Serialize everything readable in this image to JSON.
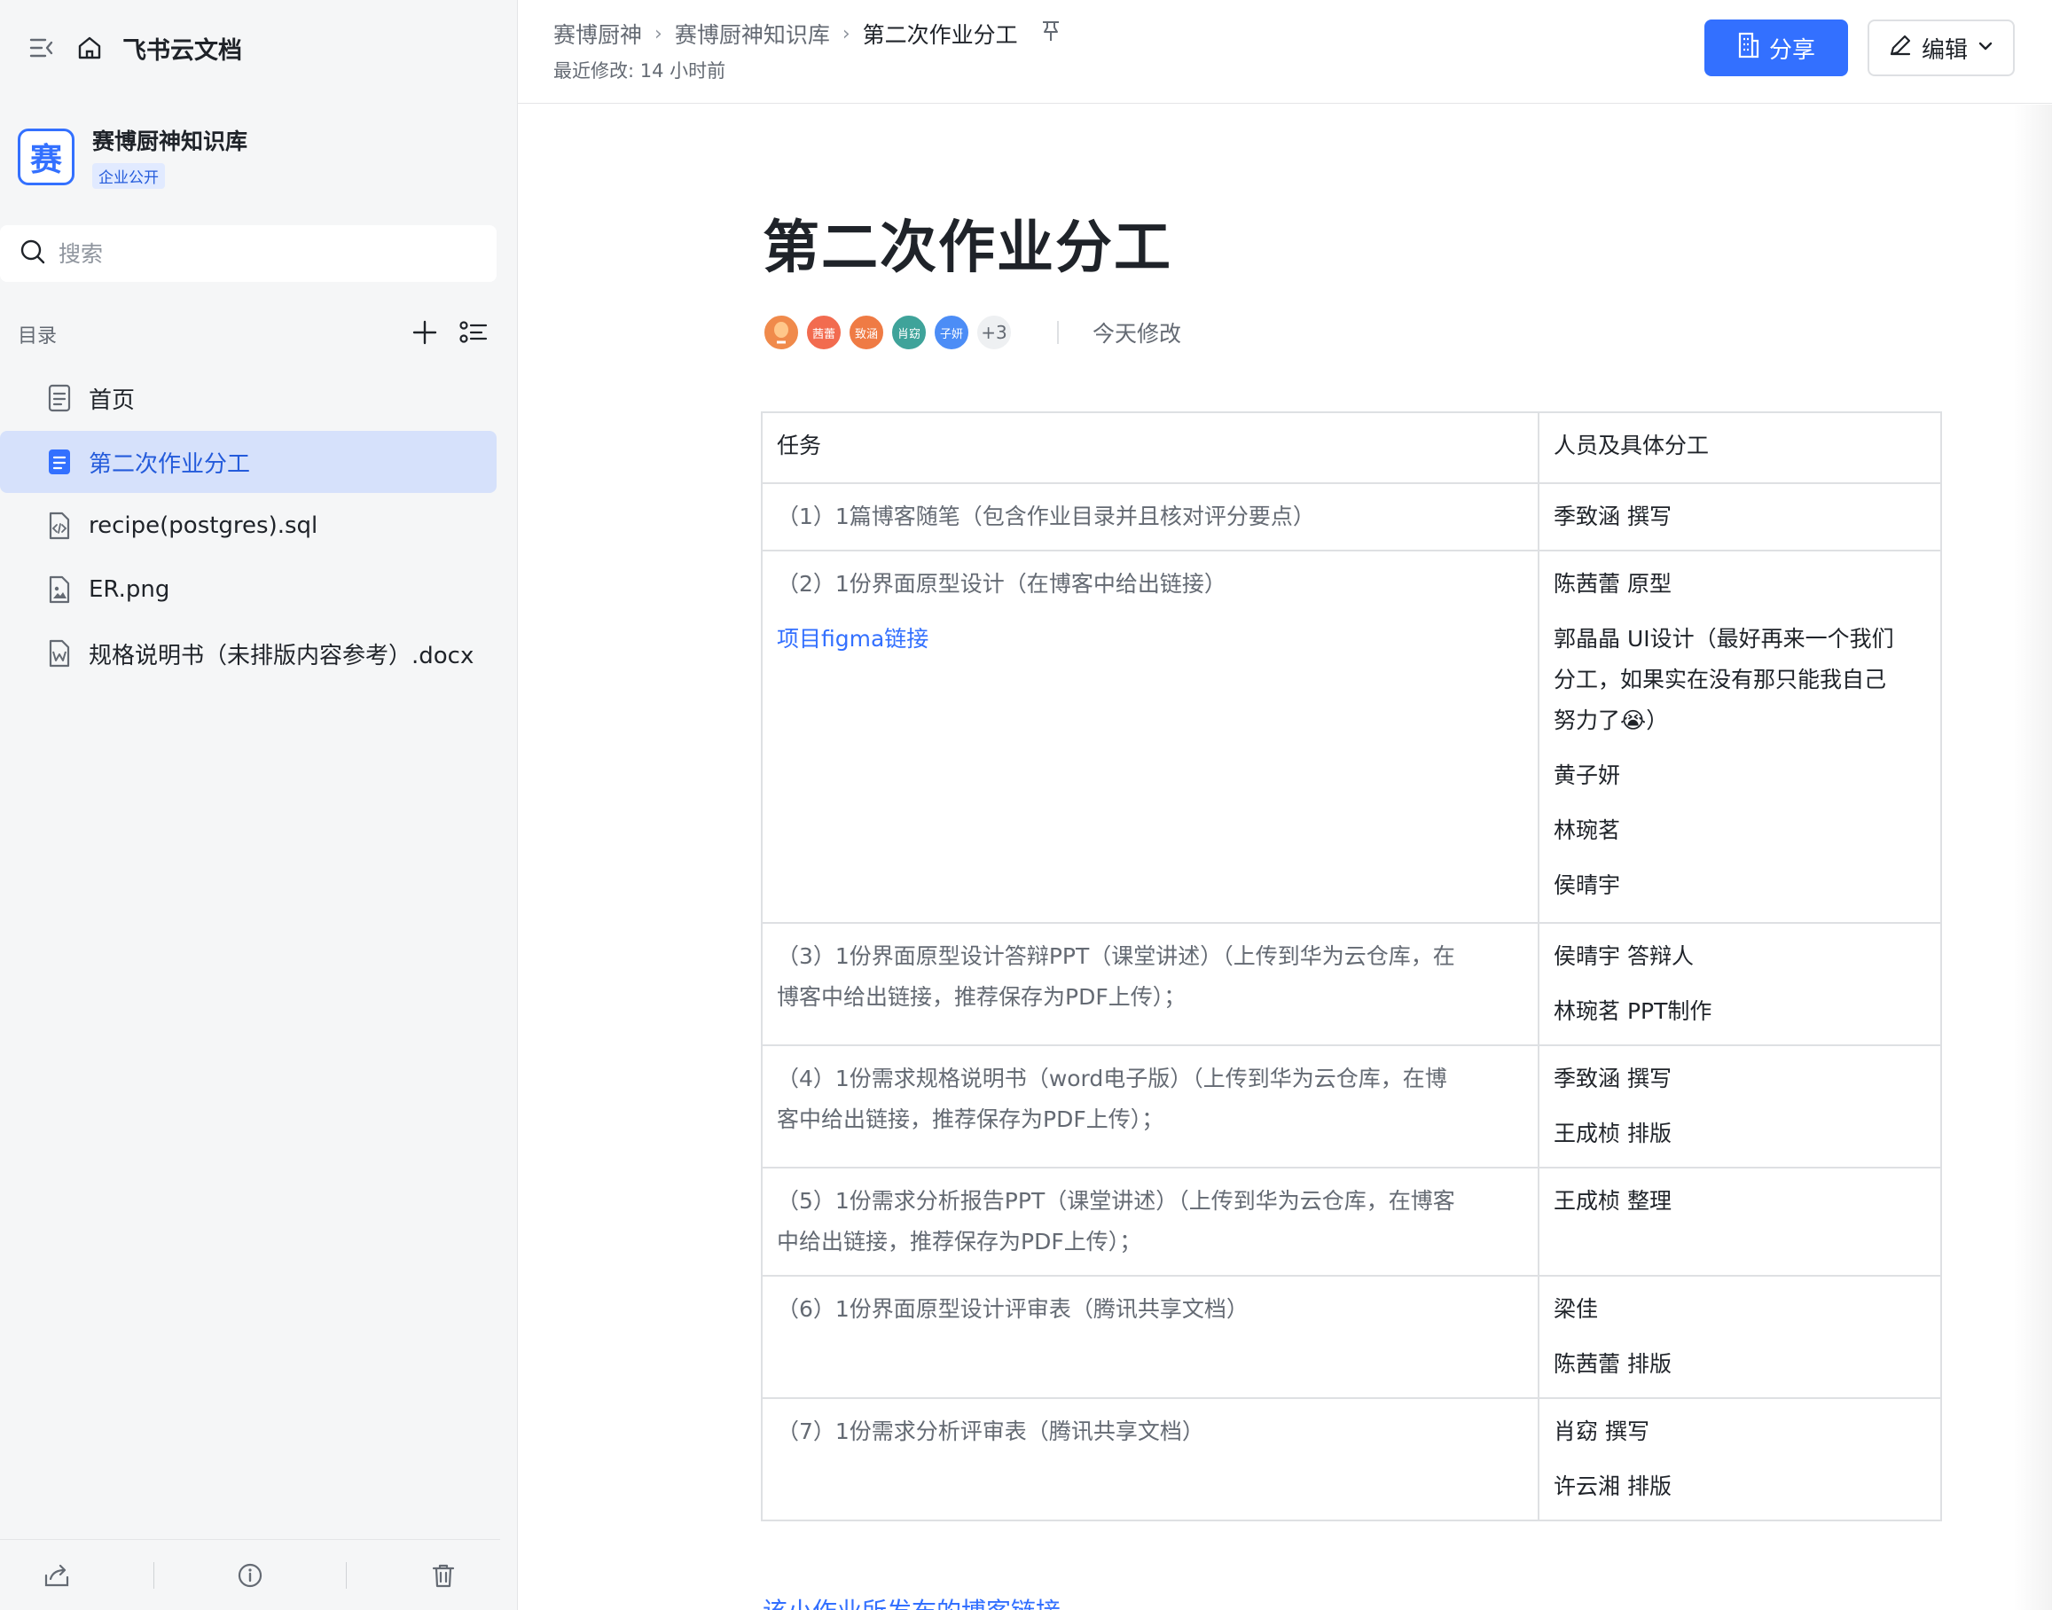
{
  "sidebar": {
    "app_name": "飞书云文档",
    "space": {
      "logo_char": "赛",
      "name": "赛博厨神知识库",
      "badge": "企业公开"
    },
    "search_placeholder": "搜索",
    "toc_title": "目录",
    "items": [
      {
        "label": "首页",
        "icon": "doc-icon",
        "active": false
      },
      {
        "label": "第二次作业分工",
        "icon": "doc-icon",
        "active": true
      },
      {
        "label": "recipe(postgres).sql",
        "icon": "code-file-icon",
        "active": false
      },
      {
        "label": "ER.png",
        "icon": "image-file-icon",
        "active": false
      },
      {
        "label": "规格说明书（未排版内容参考）.docx",
        "icon": "word-file-icon",
        "active": false
      }
    ]
  },
  "header": {
    "breadcrumbs": [
      "赛博厨神",
      "赛博厨神知识库",
      "第二次作业分工"
    ],
    "last_modified": "最近修改: 14 小时前",
    "share_label": "分享",
    "edit_label": "编辑"
  },
  "doc": {
    "title": "第二次作业分工",
    "avatars": [
      {
        "text": "",
        "color": "#f08a4b"
      },
      {
        "text": "茜蕾",
        "color": "#f26b4f"
      },
      {
        "text": "致涵",
        "color": "#ef7b44"
      },
      {
        "text": "肖窈",
        "color": "#3fa39a"
      },
      {
        "text": "子妍",
        "color": "#4c8df6"
      }
    ],
    "avatars_more": "+3",
    "modified_today": "今天修改",
    "table": {
      "headers": [
        "任务",
        "人员及具体分工"
      ],
      "rows": [
        {
          "task": [
            "（1）1篇博客随笔（包含作业目录并且核对评分要点）"
          ],
          "link": "",
          "people": [
            "季致涵 撰写"
          ]
        },
        {
          "task": [
            "（2）1份界面原型设计（在博客中给出链接）"
          ],
          "link": "项目figma链接",
          "people": [
            "陈茜蕾 原型",
            "郭晶晶 UI设计（最好再来一个我们",
            "分工，如果实在没有那只能我自己",
            "努力了😭）",
            "黄子妍",
            "林琬茗",
            "侯晴宇"
          ]
        },
        {
          "task": [
            "（3）1份界面原型设计答辩PPT（课堂讲述）（上传到华为云仓库，在",
            "博客中给出链接，推荐保存为PDF上传）；"
          ],
          "link": "",
          "people": [
            "侯晴宇  答辩人",
            "林琬茗  PPT制作"
          ]
        },
        {
          "task": [
            "（4）1份需求规格说明书（word电子版）（上传到华为云仓库，在博",
            "客中给出链接，推荐保存为PDF上传）；"
          ],
          "link": "",
          "people": [
            "季致涵 撰写",
            "王成桢 排版"
          ]
        },
        {
          "task": [
            "（5）1份需求分析报告PPT（课堂讲述）（上传到华为云仓库，在博客",
            "中给出链接，推荐保存为PDF上传）；"
          ],
          "link": "",
          "people": [
            "王成桢 整理"
          ]
        },
        {
          "task": [
            "（6）1份界面原型设计评审表（腾讯共享文档）"
          ],
          "link": "",
          "people": [
            "梁佳",
            "陈茜蕾 排版"
          ]
        },
        {
          "task": [
            "（7）1份需求分析评审表（腾讯共享文档）"
          ],
          "link": "",
          "people": [
            "肖窈 撰写",
            "许云湘 排版"
          ]
        }
      ]
    },
    "below_link": "该小作业所发布的博客链接"
  },
  "colors": {
    "accent": "#3370ff",
    "active_bg": "#d6e1fb",
    "sidebar_bg": "#f5f6f7"
  }
}
